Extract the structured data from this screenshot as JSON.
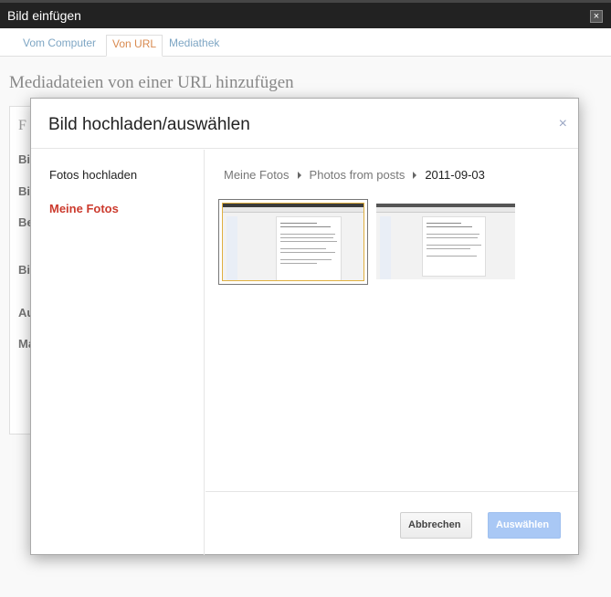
{
  "window": {
    "title": "Bild einfügen",
    "close_symbol": "×"
  },
  "tabs": [
    {
      "label": "Vom Computer"
    },
    {
      "label": "Von URL"
    },
    {
      "label": "Mediathek"
    }
  ],
  "background": {
    "heading": "Mediadateien von einer URL hinzufügen",
    "partial_labels": [
      "F",
      "Bil",
      "Bil",
      "Be",
      "Bil",
      "Au",
      "Ma"
    ]
  },
  "dialog": {
    "title": "Bild hochladen/auswählen",
    "close_symbol": "×",
    "sidebar": [
      {
        "label": "Fotos hochladen"
      },
      {
        "label": "Meine Fotos"
      }
    ],
    "breadcrumb": [
      "Meine Fotos",
      "Photos from posts",
      "2011-09-03"
    ],
    "photos": [
      {
        "name": "screenshot-1",
        "selected": true
      },
      {
        "name": "screenshot-2",
        "selected": false
      }
    ],
    "buttons": {
      "cancel": "Abbrechen",
      "choose": "Auswählen"
    }
  },
  "colors": {
    "titlebar": "#222222",
    "active_sidebar": "#cc3b2e",
    "choose_button": "#a9c8f5"
  }
}
